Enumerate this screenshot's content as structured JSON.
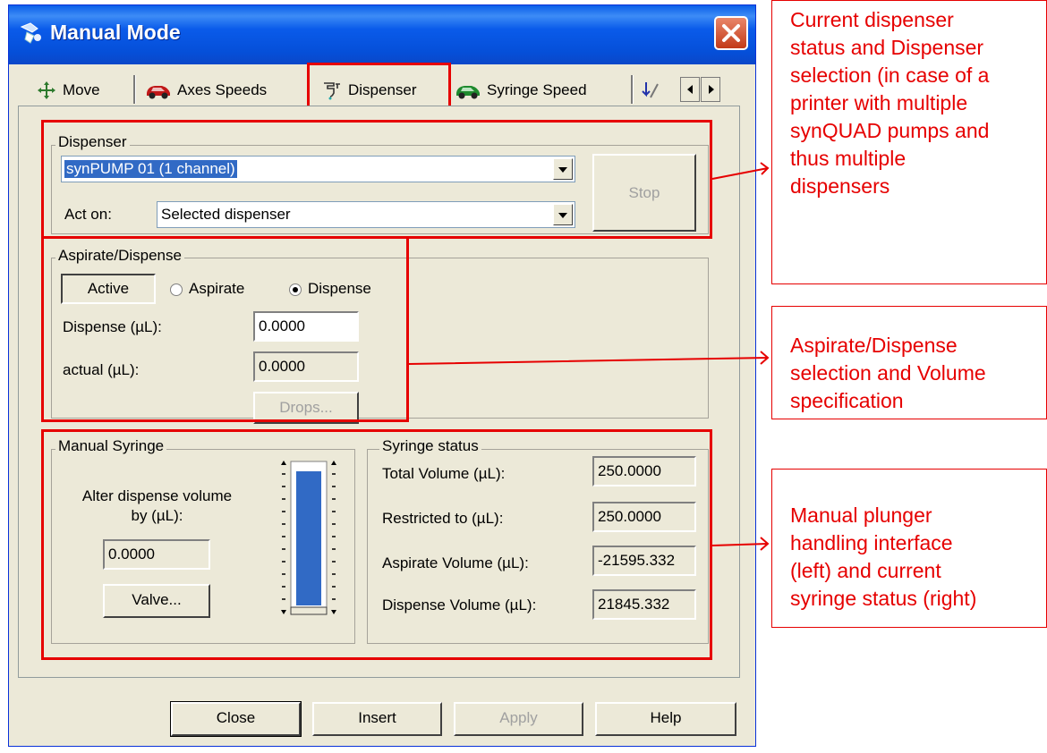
{
  "window": {
    "title": "Manual Mode"
  },
  "tabs": [
    {
      "label": "Move",
      "icon": "move-arrows-icon"
    },
    {
      "label": "Axes Speeds",
      "icon": "red-car-icon"
    },
    {
      "label": "Dispenser",
      "icon": "dispenser-icon"
    },
    {
      "label": "Syringe Speed",
      "icon": "green-car-icon"
    }
  ],
  "dispenser_group": {
    "legend": "Dispenser",
    "selected": "synPUMP 01 (1 channel)",
    "act_on_label": "Act on:",
    "act_on_value": "Selected dispenser",
    "stop_label": "Stop"
  },
  "aspirate_group": {
    "legend": "Aspirate/Dispense",
    "active_label": "Active",
    "aspirate_label": "Aspirate",
    "dispense_label": "Dispense",
    "selected_mode": "Dispense",
    "dispense_field_label": "Dispense (µL):",
    "dispense_value": "0.0000",
    "actual_label": "actual (µL):",
    "actual_value": "0.0000",
    "drops_label": "Drops..."
  },
  "manual_syringe": {
    "legend": "Manual Syringe",
    "alter_line1": "Alter dispense volume",
    "alter_line2": "by (µL):",
    "alter_value": "0.0000",
    "valve_label": "Valve...",
    "slider_level": 1.0
  },
  "syringe_status": {
    "legend": "Syringe status",
    "total_label": "Total Volume (µL):",
    "total_value": "250.0000",
    "restricted_label": "Restricted to (µL):",
    "restricted_value": "250.0000",
    "aspirate_label": "Aspirate Volume (µL):",
    "aspirate_value": "-21595.332",
    "dispense_label": "Dispense Volume (µL):",
    "dispense_value": "21845.332"
  },
  "footer": {
    "close": "Close",
    "insert": "Insert",
    "apply": "Apply",
    "help": "Help"
  },
  "callouts": {
    "c1": [
      "Current dispenser",
      "status and Dispenser",
      "selection (in case of a",
      "printer with multiple",
      "synQUAD pumps and",
      "thus multiple",
      "dispensers"
    ],
    "c2": [
      "Aspirate/Dispense",
      "selection and Volume",
      "specification"
    ],
    "c3": [
      "Manual plunger",
      "handling interface",
      "(left) and current",
      "syringe status (right)"
    ]
  },
  "colors": {
    "annotation": "#e60000",
    "titlebar": "#0a5ee8",
    "dialog": "#ece9d8"
  }
}
